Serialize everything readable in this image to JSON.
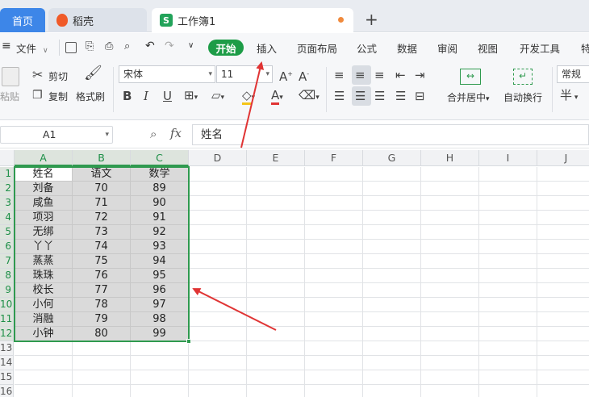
{
  "tabs": {
    "home": "首页",
    "daoke": "稻壳",
    "workbook_icon": "S",
    "workbook": "工作簿1",
    "new_tab": "+"
  },
  "menu": {
    "file": "文件",
    "items": [
      "开始",
      "插入",
      "页面布局",
      "公式",
      "数据",
      "审阅",
      "视图",
      "开发工具",
      "特"
    ]
  },
  "ribbon": {
    "paste": "粘贴",
    "cut": "剪切",
    "copy": "复制",
    "format_painter": "格式刷",
    "font_name": "宋体",
    "font_size": "11",
    "bold": "B",
    "italic": "I",
    "underline": "U",
    "merge_center": "合并居中",
    "wrap_text": "自动换行",
    "number_format": "常规",
    "currency": "半"
  },
  "formula_bar": {
    "cell_ref": "A1",
    "fx": "fx",
    "content": "姓名"
  },
  "columns": [
    "A",
    "B",
    "C",
    "D",
    "E",
    "F",
    "G",
    "H",
    "I",
    "J"
  ],
  "rows": [
    "1",
    "2",
    "3",
    "4",
    "5",
    "6",
    "7",
    "8",
    "9",
    "10",
    "11",
    "12",
    "13",
    "14",
    "15",
    "16"
  ],
  "table": {
    "headers": [
      "姓名",
      "语文",
      "数学"
    ],
    "data": [
      [
        "刘备",
        "70",
        "89"
      ],
      [
        "咸鱼",
        "71",
        "90"
      ],
      [
        "项羽",
        "72",
        "91"
      ],
      [
        "无绑",
        "73",
        "92"
      ],
      [
        "丫丫",
        "74",
        "93"
      ],
      [
        "蒸蒸",
        "75",
        "94"
      ],
      [
        "珠珠",
        "76",
        "95"
      ],
      [
        "校长",
        "77",
        "96"
      ],
      [
        "小何",
        "78",
        "97"
      ],
      [
        "消融",
        "79",
        "98"
      ],
      [
        "小钟",
        "80",
        "99"
      ]
    ]
  },
  "colors": {
    "accent_green": "#1d9c47",
    "tab_blue": "#3d86e8",
    "arrow_red": "#e03434",
    "selection_fill": "#dadada"
  }
}
